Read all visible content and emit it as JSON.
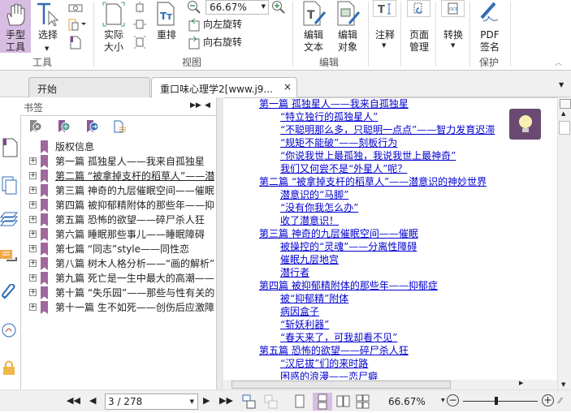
{
  "ribbon": {
    "hand_tool": "手型\n工具",
    "select": "选择",
    "tools_group": "工具",
    "actual_size": "实际\n大小",
    "reflow": "重排",
    "zoom_value": "66.67%",
    "rotate_left": "向左旋转",
    "rotate_right": "向右旋转",
    "view_group": "视图",
    "edit_text": "编辑\n文本",
    "edit_object": "编辑\n对象",
    "edit_group": "编辑",
    "annotate": "注释",
    "page_manage": "页面\n管理",
    "convert": "转换",
    "pdf_sign": "PDF\n签名",
    "protect_group": "保护"
  },
  "tabs": [
    {
      "label": "开始"
    },
    {
      "label": "重口味心理学2[www.j9..."
    }
  ],
  "bookmarks": {
    "title": "书签",
    "items": [
      {
        "label": "版权信息",
        "expandable": false
      },
      {
        "label": "第一篇 孤独星人——我来自孤独星",
        "expandable": true
      },
      {
        "label": "第二篇 “被拿掉支杆的稻草人”——潜意识的神妙世界",
        "expandable": true
      },
      {
        "label": "第三篇 神奇的九层催眠空间——催眠",
        "expandable": true
      },
      {
        "label": "第四篇 被抑郁精附体的那些年——抑郁症",
        "expandable": true
      },
      {
        "label": "第五篇 恐怖的欲望——碎尸杀人狂",
        "expandable": true
      },
      {
        "label": "第六篇 睡眠那些事儿——睡眠障碍",
        "expandable": true
      },
      {
        "label": "第七篇 “同志”style——同性恋",
        "expandable": true
      },
      {
        "label": "第八篇 树木人格分析——“画的解析”",
        "expandable": true
      },
      {
        "label": "第九篇 死亡是一生中最大的高潮——",
        "expandable": true
      },
      {
        "label": "第十篇 “失乐园”——那些与性有关的",
        "expandable": true
      },
      {
        "label": "第十一篇 生不如死——创伤后应激障碍",
        "expandable": true
      }
    ]
  },
  "document": {
    "lines": [
      {
        "text": "第一篇  孤独星人——我来自孤独星",
        "level": 1
      },
      {
        "text": "“特立独行的孤独星人”",
        "level": 2
      },
      {
        "text": "“不聪明那么多，只聪明一点点”——智力发育迟滞",
        "level": 2
      },
      {
        "text": "“规矩不能破”——刻板行为",
        "level": 2
      },
      {
        "text": "“你说我世上最孤独，我说我世上最神奇”",
        "level": 2
      },
      {
        "text": "我们又何尝不是“外星人”呢？",
        "level": 2
      },
      {
        "text": "第二篇  “被拿掉支杆的稻草人”——潜意识的神妙世界",
        "level": 1
      },
      {
        "text": "潜意识的“马脚”",
        "level": 2
      },
      {
        "text": "“没有你我怎么办”",
        "level": 2
      },
      {
        "text": "收了潜意识！",
        "level": 2
      },
      {
        "text": "第三篇  神奇的九层催眠空间——催眠",
        "level": 1
      },
      {
        "text": "被操控的“灵魂”——分离性障碍",
        "level": 2
      },
      {
        "text": "催眠九层地宫",
        "level": 2
      },
      {
        "text": "潜行者",
        "level": 2
      },
      {
        "text": "第四篇  被抑郁精附体的那些年——抑郁症",
        "level": 1
      },
      {
        "text": "被“抑郁精”附体",
        "level": 2
      },
      {
        "text": "病因盒子",
        "level": 2
      },
      {
        "text": "“斩妖利器”",
        "level": 2
      },
      {
        "text": "“春天来了，可我却看不见”",
        "level": 2
      },
      {
        "text": "第五篇  恐怖的欲望——碎尸杀人狂",
        "level": 1
      },
      {
        "text": "“汉尼拔”们的来时路",
        "level": 2
      },
      {
        "text": "困惑的浪漫——恋尸癖",
        "level": 2
      }
    ]
  },
  "status": {
    "page": "3 / 278",
    "zoom": "66.67%",
    "zoom_slider_fraction": 0.45
  },
  "colors": {
    "accent": "#d7bde2",
    "link": "#0000d0",
    "bookmark": "#a0689c"
  }
}
